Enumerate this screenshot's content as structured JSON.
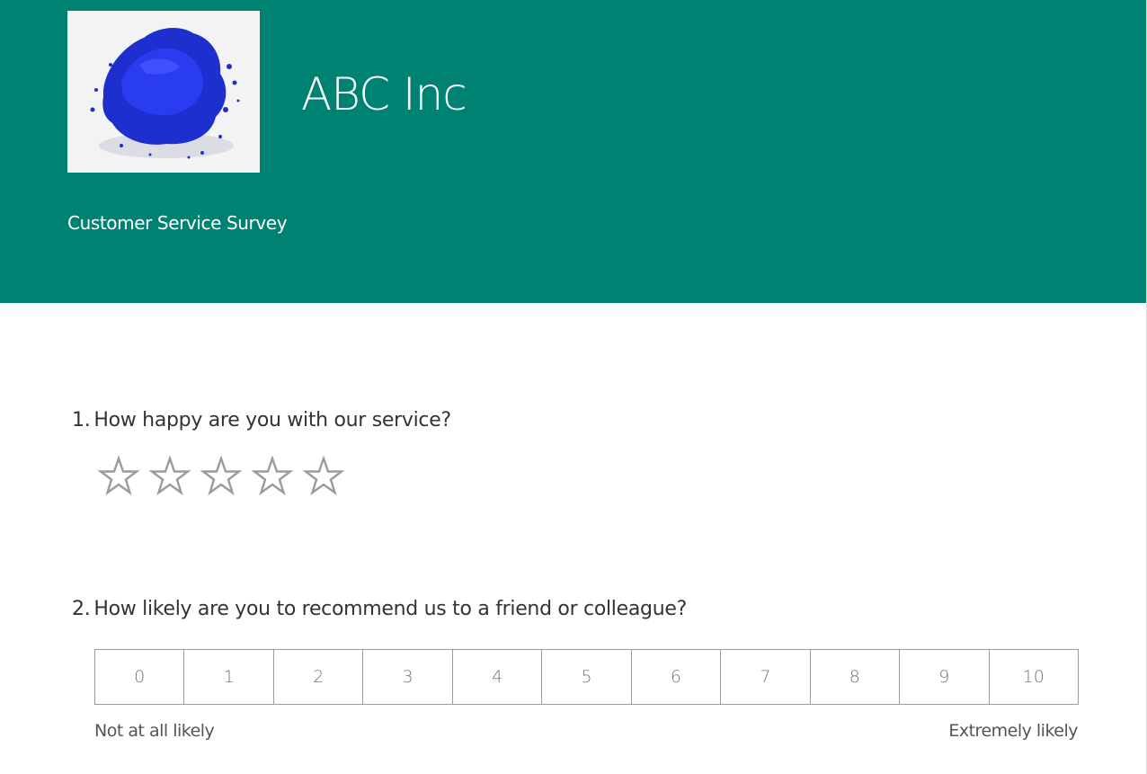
{
  "header": {
    "brand_title": "ABC Inc",
    "survey_title": "Customer Service Survey",
    "logo_icon": "blue-pigment-image",
    "background_color": "#008272"
  },
  "questions": [
    {
      "number": "1.",
      "text": "How happy are you with our service?",
      "type": "star-rating",
      "stars": 5,
      "selected": 0
    },
    {
      "number": "2.",
      "text": "How likely are you to recommend us to a friend or colleague?",
      "type": "nps",
      "scale": [
        "0",
        "1",
        "2",
        "3",
        "4",
        "5",
        "6",
        "7",
        "8",
        "9",
        "10"
      ],
      "low_label": "Not at all likely",
      "high_label": "Extremely likely"
    }
  ]
}
